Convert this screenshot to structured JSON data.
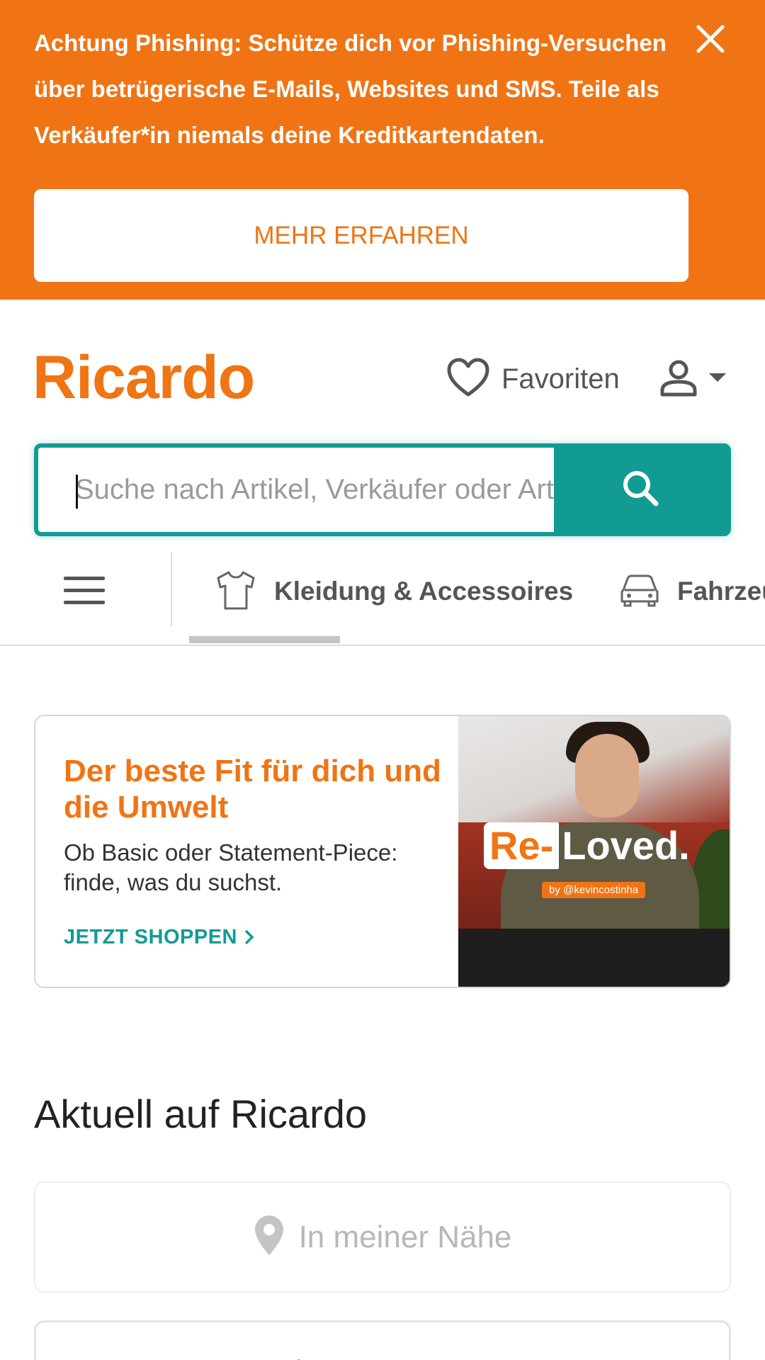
{
  "banner": {
    "message": "Achtung Phishing: Schütze dich vor Phishing-Versuchen über betrügerische E-Mails, Websites und SMS. Teile als Verkäufer*in niemals deine Kreditkartendaten.",
    "button_label": "MEHR ERFAHREN",
    "close_icon": "close-icon"
  },
  "header": {
    "logo": "Ricardo",
    "favorites_label": "Favoriten",
    "favorites_icon": "heart-icon",
    "account_icon": "user-icon"
  },
  "search": {
    "placeholder": "Suche nach Artikel, Verkäufer oder Artikelnummer",
    "value": "",
    "button_icon": "search-icon"
  },
  "category_nav": {
    "menu_icon": "hamburger-icon",
    "items": [
      {
        "label": "Kleidung & Accessoires",
        "icon": "tshirt-icon"
      },
      {
        "label": "Fahrzeuge",
        "icon": "car-icon"
      }
    ]
  },
  "promo": {
    "title": "Der beste Fit für dich und die Umwelt",
    "subtitle": "Ob Basic oder Statement-Piece: finde, was du suchst.",
    "cta": "JETZT SHOPPEN",
    "image_logo_re": "Re-",
    "image_logo_rest": "Loved.",
    "image_credit": "by @kevincostinha"
  },
  "section": {
    "title": "Aktuell auf Ricardo",
    "near_me_label": "In meiner Nähe",
    "near_me_icon": "location-pin-icon"
  },
  "colors": {
    "brand_orange": "#f07414",
    "search_teal": "#129b93"
  }
}
